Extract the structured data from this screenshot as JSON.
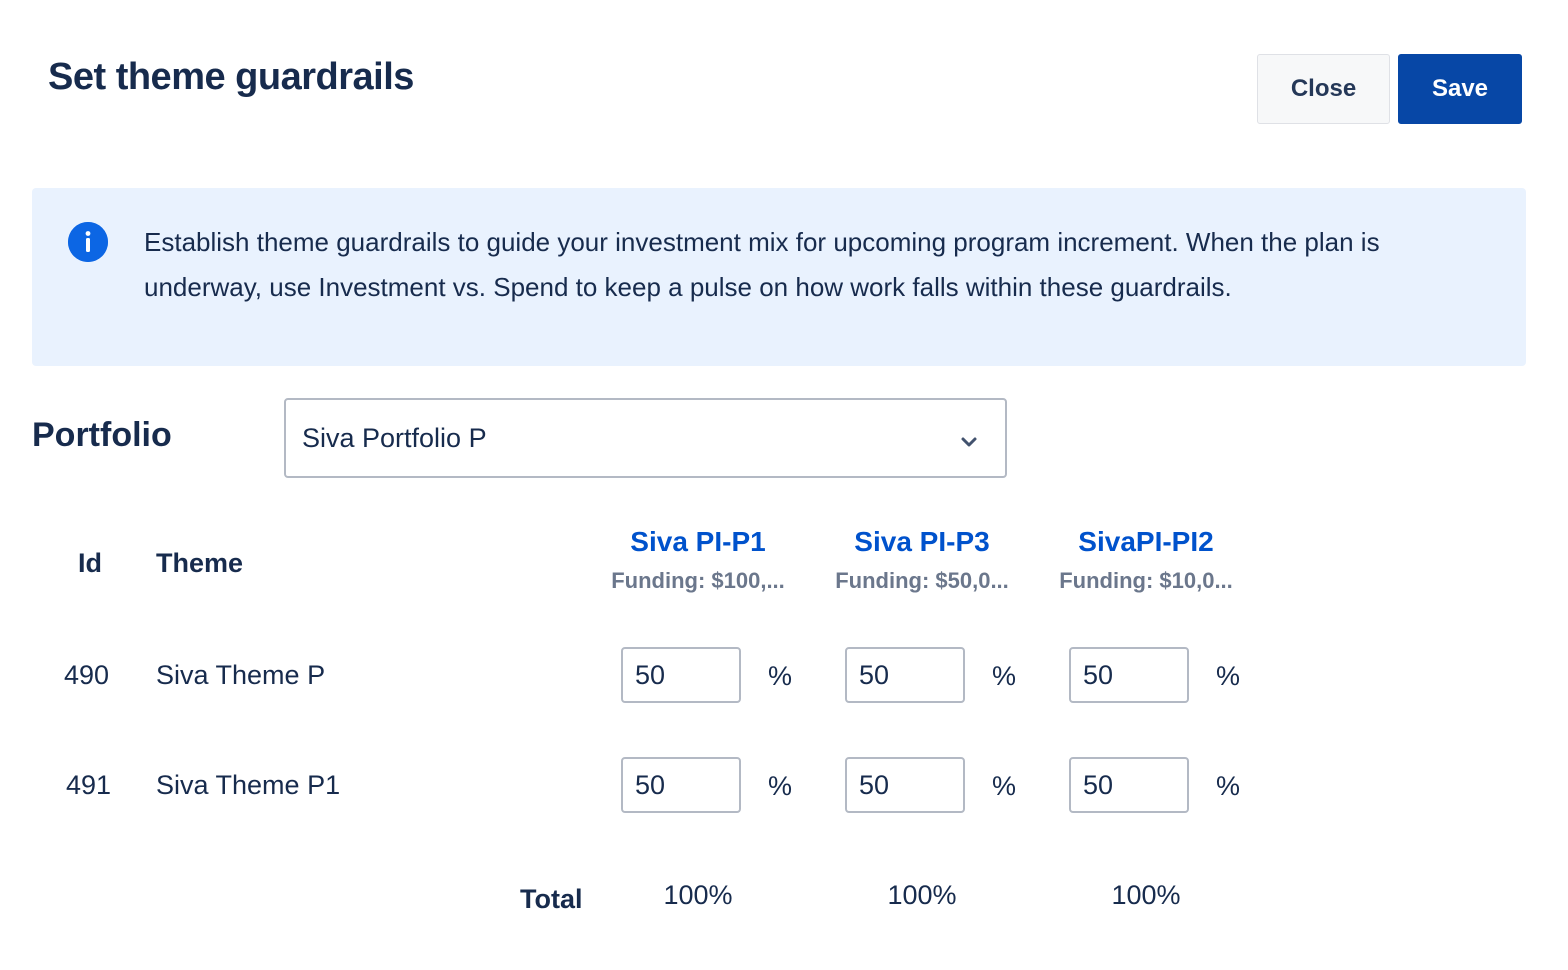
{
  "header": {
    "title": "Set theme guardrails",
    "close_label": "Close",
    "save_label": "Save"
  },
  "info_banner": {
    "icon": "info-icon",
    "text": "Establish theme guardrails to guide your investment mix for upcoming program increment. When the plan is underway, use Investment vs. Spend to keep a pulse on how work falls within these guardrails."
  },
  "portfolio": {
    "label": "Portfolio",
    "selected": "Siva Portfolio P"
  },
  "table": {
    "id_header": "Id",
    "theme_header": "Theme",
    "increments": [
      {
        "name": "Siva PI-P1",
        "funding": "Funding: $100,..."
      },
      {
        "name": "Siva PI-P3",
        "funding": "Funding: $50,0..."
      },
      {
        "name": "SivaPI-PI2",
        "funding": "Funding: $10,0..."
      }
    ],
    "rows": [
      {
        "id": "490",
        "theme": "Siva Theme P",
        "values": [
          "50",
          "50",
          "50"
        ]
      },
      {
        "id": "491",
        "theme": "Siva Theme P1",
        "values": [
          "50",
          "50",
          "50"
        ]
      }
    ],
    "percent_sign": "%",
    "total_label": "Total",
    "totals": [
      "100%",
      "100%",
      "100%"
    ]
  },
  "colors": {
    "primary": "#0747a6",
    "link": "#0052cc",
    "banner_bg": "#e9f2fe",
    "info_icon": "#0c66e4"
  }
}
